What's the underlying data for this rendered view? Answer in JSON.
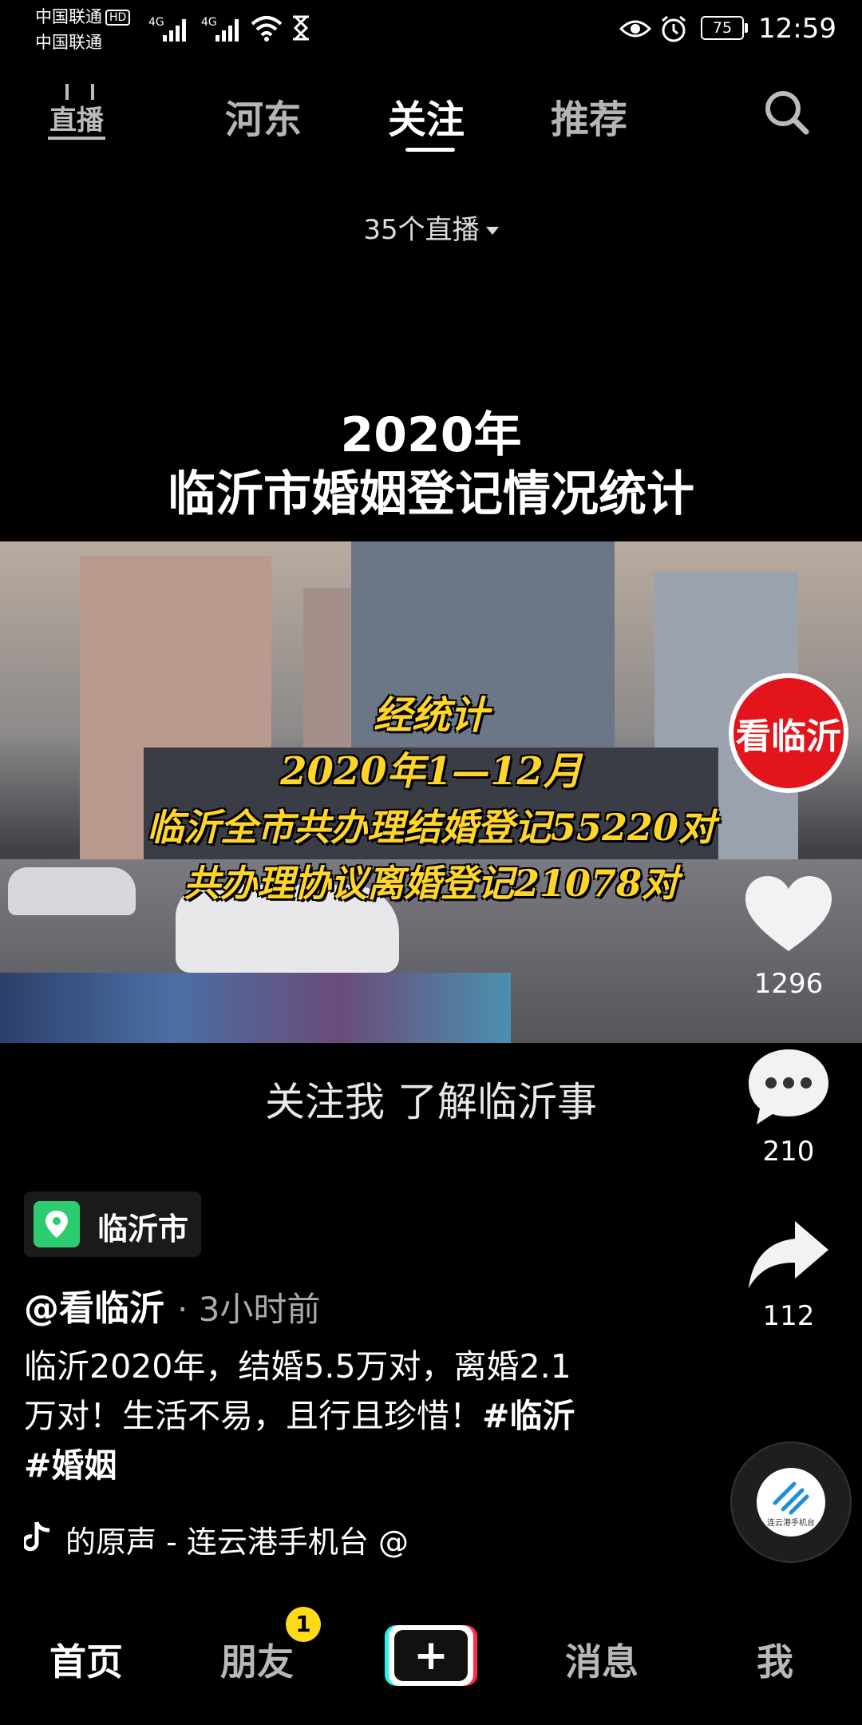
{
  "status_bar": {
    "carrier_line1": "中国联通",
    "carrier_line2": "中国联通",
    "hd_badge": "HD",
    "network_1": "4G",
    "network_2": "4G",
    "battery": "75",
    "time": "12:59",
    "icons": [
      "signal-icon",
      "wifi-icon",
      "hourglass-icon",
      "eye-icon",
      "alarm-icon",
      "battery-icon"
    ]
  },
  "top_nav": {
    "live_label": "直播",
    "tabs": [
      {
        "label": "河东"
      },
      {
        "label": "关注"
      },
      {
        "label": "推荐"
      }
    ],
    "active_tab": "关注",
    "search_icon": "search-icon"
  },
  "live_count": "35个直播",
  "video": {
    "title_line1": "2020年",
    "title_line2": "临沂市婚姻登记情况统计",
    "overlay_lines": [
      "经统计",
      "2020年1—12月",
      "临沂全市共办理结婚登记55220对",
      "共办理协议离婚登记21078对"
    ],
    "subcaption": "关注我 了解临沂事"
  },
  "actions": {
    "avatar_text": "看临沂",
    "likes": "1296",
    "comments": "210",
    "shares": "112"
  },
  "info": {
    "location": "临沂市",
    "handle": "@看临沂",
    "time_ago": "· 3小时前",
    "description_line1": "临沂2020年，结婚5.5万对，离婚2.1",
    "description_line2": "万对！生活不易，且行且珍惜！",
    "tag1": "#临沂",
    "tag2": "#婚姻",
    "music": "的原声 - 连云港手机台    @",
    "disc_label": "连云港手机台"
  },
  "bottom_nav": {
    "home": "首页",
    "friends": "朋友",
    "friends_badge": "1",
    "create": "+",
    "messages": "消息",
    "me": "我"
  },
  "colors": {
    "accent_cyan": "#25f4ee",
    "accent_red": "#fe2c55",
    "badge_yellow": "#fedb1a",
    "avatar_red": "#e3141b",
    "overlay_yellow": "#ffd52a",
    "location_green": "#2ecc71"
  }
}
